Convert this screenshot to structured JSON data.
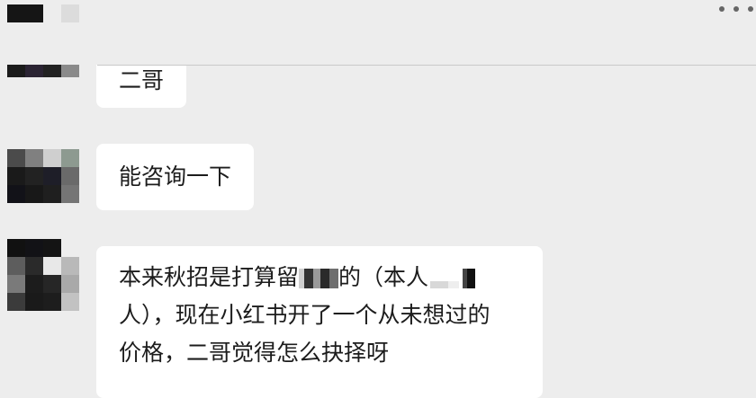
{
  "header": {
    "more_icon": "more-dots-icon"
  },
  "messages": [
    {
      "sender": "contact",
      "text": "二哥"
    },
    {
      "sender": "contact",
      "text": "能咨询一下"
    },
    {
      "sender": "contact",
      "line1_before": "本来秋招是打算留",
      "line1_after": "的（本人",
      "line2": "人），现在小红书开了一个从未想过的",
      "line3": "价格，二哥觉得怎么抉择呀"
    }
  ],
  "colors": {
    "background": "#ededed",
    "bubble": "#ffffff",
    "text": "#1c1c1c",
    "divider": "#c9c9c9"
  }
}
